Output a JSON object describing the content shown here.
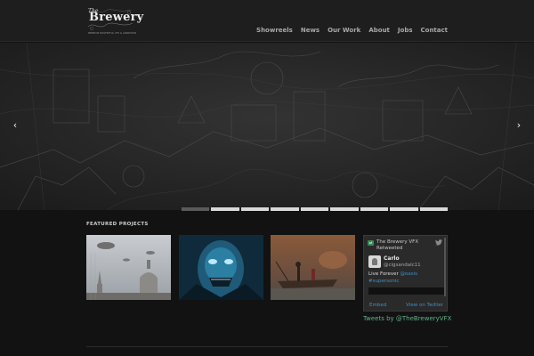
{
  "header": {
    "logo": {
      "the": "The",
      "word": "Brewery",
      "tagline": "PREMIUM MASTERFUL VFX & ANIMATION"
    },
    "nav": [
      "Showreels",
      "News",
      "Our Work",
      "About",
      "Jobs",
      "Contact"
    ]
  },
  "slider": {
    "prev_icon": "‹",
    "next_icon": "›",
    "tab_count": 9,
    "active_tab": 0
  },
  "featured": {
    "title": "FEATURED PROJECTS"
  },
  "twitter": {
    "retweet_line1": "The Brewery VFX",
    "retweet_line2": "Retweeted",
    "name": "Carlo",
    "handle": "@cigsandalc11",
    "tweet_text": "Live Forever ",
    "tweet_link1": "@oasis",
    "tweet_link2": "#supersonic",
    "embed": "Embed",
    "view_on_twitter": "View on Twitter",
    "tweets_by": "Tweets by @TheBreweryVFX"
  },
  "colors": {
    "accent": "#3d8fc6",
    "tweets_by": "#5fb38a",
    "background": "#121212"
  }
}
